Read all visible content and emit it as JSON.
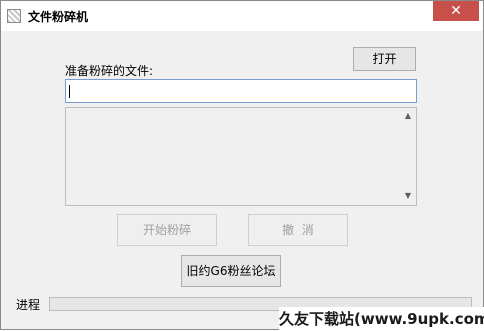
{
  "window": {
    "title": "文件粉碎机",
    "close_glyph": "✕"
  },
  "file_label": "准备粉碎的文件:",
  "file_input": {
    "value": "",
    "placeholder": ""
  },
  "file_list": [],
  "buttons": {
    "open": "打开",
    "start": "开始粉碎",
    "cancel": "撤  消",
    "forum": "旧约G6粉丝论坛"
  },
  "progress": {
    "label": "进程",
    "value": 0
  },
  "watermark": "久友下载站(www.9upk.com)",
  "icons": {
    "app": "shredder-app-icon",
    "close": "close-icon",
    "scroll_up": "chevron-up-icon",
    "scroll_down": "chevron-down-icon"
  },
  "colors": {
    "close_button": "#c7504a",
    "input_border": "#7a9cd3",
    "progress_fill": "#06b025"
  }
}
